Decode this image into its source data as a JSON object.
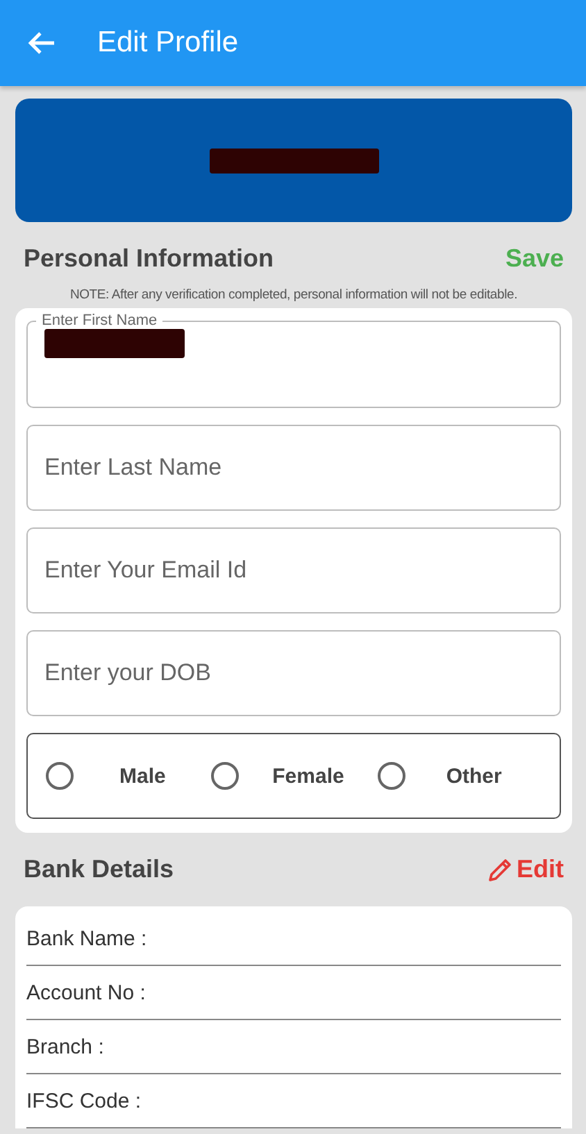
{
  "app_bar": {
    "title": "Edit Profile"
  },
  "personal": {
    "heading": "Personal Information",
    "action": "Save",
    "note": "NOTE: After any verification completed, personal information will not be editable.",
    "fields": [
      {
        "kind": "filled",
        "label": "Enter First Name"
      },
      {
        "kind": "empty",
        "placeholder": "Enter Last Name"
      },
      {
        "kind": "empty",
        "placeholder": "Enter Your Email Id"
      },
      {
        "kind": "empty",
        "placeholder": "Enter your DOB"
      }
    ],
    "gender": [
      {
        "label": "Male",
        "selected": false
      },
      {
        "label": "Female",
        "selected": false
      },
      {
        "label": "Other",
        "selected": false
      }
    ]
  },
  "bank": {
    "heading": "Bank Details",
    "action": "Edit",
    "rows": [
      {
        "label": "Bank Name :"
      },
      {
        "label": "Account No :"
      },
      {
        "label": "Branch :"
      },
      {
        "label": "IFSC Code :"
      }
    ]
  }
}
